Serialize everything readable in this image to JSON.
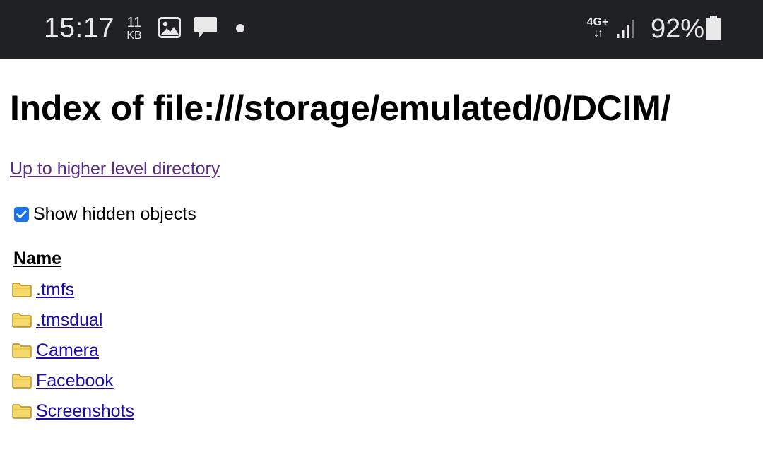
{
  "status_bar": {
    "time": "15:17",
    "data_speed_value": "11",
    "data_speed_unit": "KB",
    "network_type": "4G+",
    "network_arrows": "↓↑",
    "battery_percent": "92%",
    "icons": [
      "image-icon",
      "chat-icon",
      "dot-icon",
      "signal-icon",
      "battery-icon"
    ]
  },
  "page": {
    "title": "Index of file:///storage/emulated/0/DCIM/",
    "up_link_label": "Up to higher level directory",
    "show_hidden_label": "Show hidden objects",
    "show_hidden_checked": true,
    "name_column_header": "Name",
    "entries": [
      {
        "name": ".tmfs",
        "type": "folder"
      },
      {
        "name": ".tmsdual",
        "type": "folder"
      },
      {
        "name": "Camera",
        "type": "folder"
      },
      {
        "name": "Facebook",
        "type": "folder"
      },
      {
        "name": "Screenshots",
        "type": "folder"
      }
    ]
  },
  "colors": {
    "status_bar_bg": "#202124",
    "visited_link": "#5b2a86",
    "link": "#1a0dab",
    "checkbox_accent": "#1a73e8",
    "folder_fill": "#f6d96b"
  }
}
